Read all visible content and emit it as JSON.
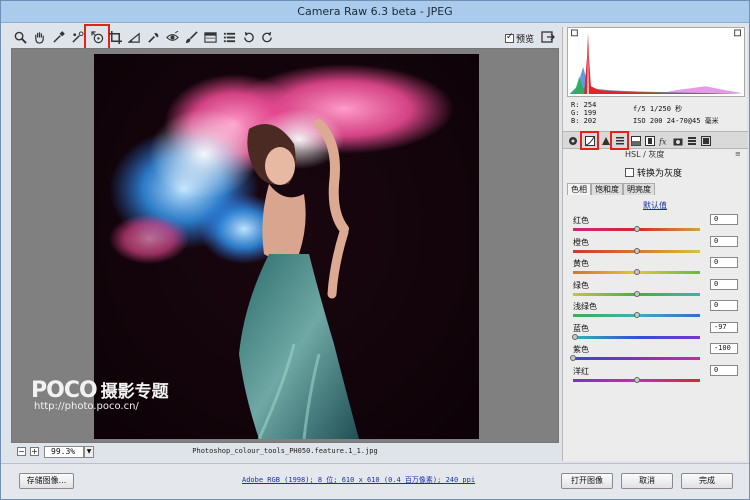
{
  "window": {
    "title": "Camera Raw 6.3 beta -  JPEG"
  },
  "toolbar": {
    "tools": [
      {
        "icon": "zoom-icon"
      },
      {
        "icon": "hand-icon"
      },
      {
        "icon": "white-balance-icon"
      },
      {
        "icon": "color-sampler-icon"
      },
      {
        "icon": "targeted-adjustment-icon"
      },
      {
        "icon": "crop-icon"
      },
      {
        "icon": "straighten-icon"
      },
      {
        "icon": "spot-removal-icon"
      },
      {
        "icon": "red-eye-icon"
      },
      {
        "icon": "adjustment-brush-icon"
      },
      {
        "icon": "graduated-filter-icon"
      },
      {
        "icon": "preferences-icon"
      },
      {
        "icon": "rotate-left-icon"
      },
      {
        "icon": "rotate-right-icon"
      }
    ],
    "highlight_color": "#e1231c",
    "preview_label": "预览",
    "preview_checked": true
  },
  "image": {
    "filename": "Photoshop_colour_tools_PH050.feature.1_1.jpg",
    "zoom": "99.3%"
  },
  "info": {
    "r": "R:  254",
    "g": "G:  199",
    "b": "B:  202",
    "aperture_shutter": "f/5   1/250 秒",
    "iso_lens": "ISO 200   24-70@45 毫米"
  },
  "panel": {
    "section_title": "HSL / 灰度",
    "grayscale_label": "转换为灰度",
    "grayscale_checked": false,
    "sub_tabs": [
      "色相",
      "饱和度",
      "明亮度"
    ],
    "default_link": "默认值",
    "sliders": [
      {
        "label": "红色",
        "value": "0",
        "level": 0,
        "colors": [
          "#c9287c",
          "#d02a2a",
          "#d5a23a"
        ]
      },
      {
        "label": "橙色",
        "value": "0",
        "level": 0,
        "colors": [
          "#c83838",
          "#d9772a",
          "#d4c43a"
        ]
      },
      {
        "label": "黄色",
        "value": "0",
        "level": 0,
        "colors": [
          "#d4762c",
          "#d9cc36",
          "#6cba3a"
        ]
      },
      {
        "label": "绿色",
        "value": "0",
        "level": 0,
        "colors": [
          "#c9c436",
          "#43b23c",
          "#38b4b4"
        ]
      },
      {
        "label": "浅绿色",
        "value": "0",
        "level": 0,
        "colors": [
          "#3ab14a",
          "#3ab2b8",
          "#3a6ad0"
        ]
      },
      {
        "label": "蓝色",
        "value": "-97",
        "level": -97,
        "colors": [
          "#34b4b4",
          "#2e54d2",
          "#7c34cc"
        ]
      },
      {
        "label": "紫色",
        "value": "-100",
        "level": -100,
        "colors": [
          "#3848d0",
          "#7a30cc",
          "#c82e9a"
        ]
      },
      {
        "label": "洋红",
        "value": "0",
        "level": 0,
        "colors": [
          "#7a30cc",
          "#c82ea4",
          "#d02a36"
        ]
      }
    ]
  },
  "bottom": {
    "save_label": "存储图像...",
    "workflow_link": "Adobe RGB (1998); 8 位; 610 x 610 (0.4 百万像素); 240 ppi",
    "open_label": "打开图像",
    "cancel_label": "取消",
    "done_label": "完成"
  },
  "watermark": {
    "logo": "POCO",
    "brand": "摄影专题",
    "url": "http://photo.poco.cn/"
  }
}
